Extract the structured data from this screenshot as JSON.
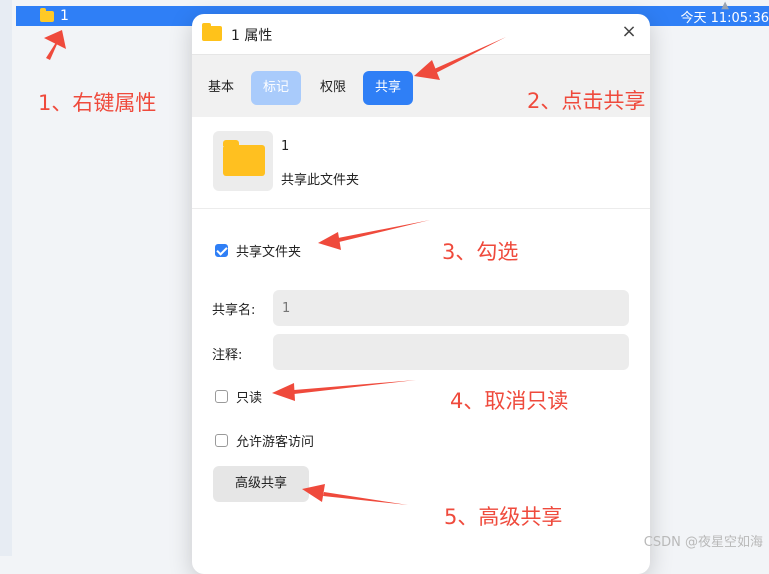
{
  "file_list": {
    "selected_item": "1",
    "clock": "今天 11:05:36"
  },
  "dialog": {
    "title": "1 属性",
    "close": "×",
    "tabs": [
      "基本",
      "标记",
      "权限",
      "共享"
    ],
    "active_tab": "共享",
    "folder_name": "1",
    "folder_desc": "共享此文件夹",
    "share_checkbox": {
      "label": "共享文件夹",
      "checked": true
    },
    "share_name": {
      "label": "共享名:",
      "placeholder": "1"
    },
    "comment": {
      "label": "注释:",
      "placeholder": ""
    },
    "readonly_checkbox": {
      "label": "只读",
      "checked": false
    },
    "guest_checkbox": {
      "label": "允许游客访问",
      "checked": false
    },
    "advanced_button": "高级共享"
  },
  "annotations": [
    "1、右键属性",
    "2、点击共享",
    "3、勾选",
    "4、取消只读",
    "5、高级共享"
  ],
  "watermark": "CSDN @夜星空如海",
  "colors": {
    "accent": "#2f7ff6",
    "annotation": "#ef4a3c",
    "folder": "#ffc21a"
  }
}
